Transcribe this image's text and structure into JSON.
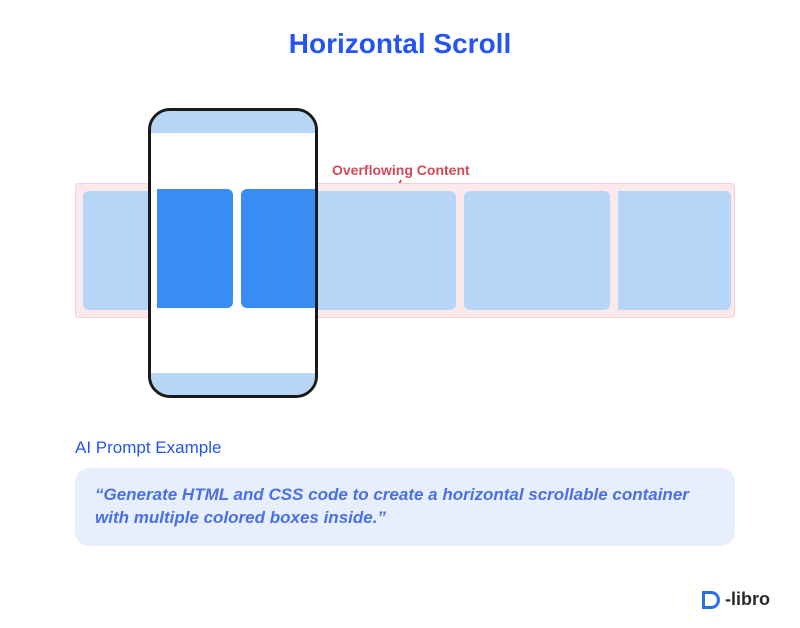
{
  "title": "Horizontal Scroll",
  "annotation": "Overflowing Content",
  "prompt_label": "AI Prompt Example",
  "prompt_text": "“Generate HTML and CSS code to create a horizontal scrollable container with multiple colored boxes inside.”",
  "brand": {
    "name": "D-libro",
    "text_after_d": "-libro"
  },
  "colors": {
    "primary_blue": "#2455f0",
    "box_light": "#b7d5f7",
    "box_dark": "#3a8cf5",
    "overflow_bg": "#fde9eb",
    "annotation_red": "#d04a5a",
    "prompt_bg": "#e8effc"
  },
  "diagram": {
    "boxes_total": 5,
    "boxes_visible_in_viewport": 2,
    "phone_viewport": true
  }
}
